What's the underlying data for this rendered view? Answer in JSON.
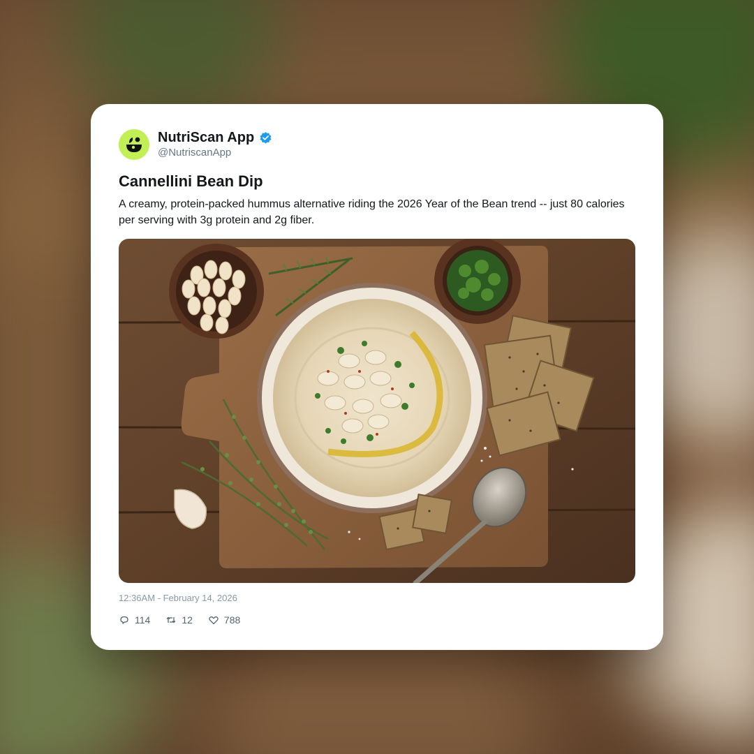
{
  "post": {
    "account": {
      "display_name": "NutriScan App",
      "handle": "@NutriscanApp",
      "verified": true,
      "avatar_color": "#c2ef55"
    },
    "title": "Cannellini Bean Dip",
    "body": "A creamy, protein-packed hummus alternative riding the 2026 Year of the Bean trend -- just 80 calories per serving with 3g protein and 2g fiber.",
    "timestamp": "12:36AM - February 14, 2026",
    "stats": {
      "replies": "114",
      "retweets": "12",
      "likes": "788"
    }
  },
  "icons": {
    "verified": "verified-badge-icon",
    "reply": "reply-icon",
    "retweet": "retweet-icon",
    "like": "heart-icon"
  },
  "colors": {
    "verified_blue": "#1d9bf0",
    "text_primary": "#14171a",
    "text_secondary": "#657786"
  }
}
